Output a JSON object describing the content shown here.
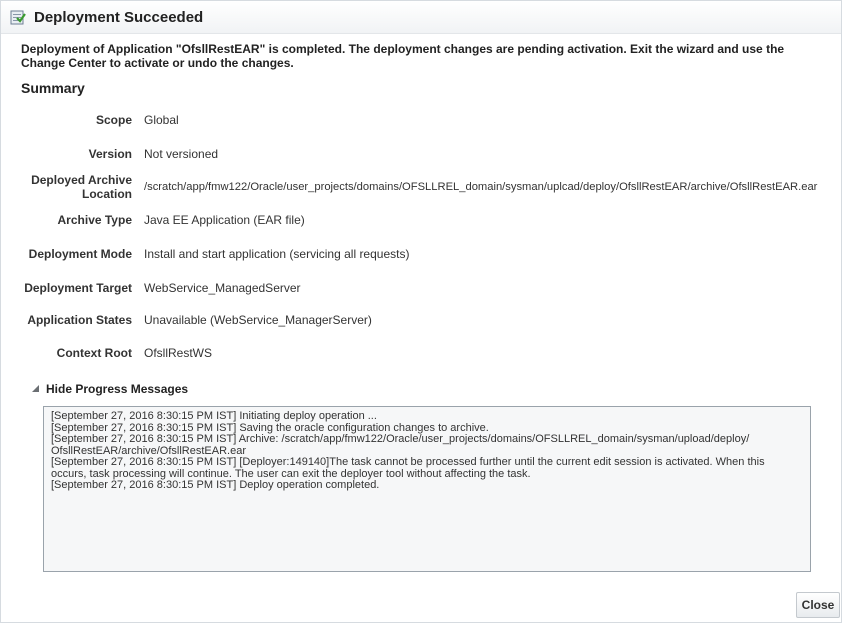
{
  "dialog": {
    "title": "Deployment Succeeded",
    "title_icon": "deployment-success-icon",
    "message": "Deployment of Application \"OfsllRestEAR\" is completed. The deployment changes are pending activation. Exit the wizard and use the Change Center to activate or undo the changes."
  },
  "summary": {
    "title": "Summary",
    "rows": [
      {
        "label": "Scope",
        "value": "Global"
      },
      {
        "label": "Version",
        "value": "Not versioned"
      },
      {
        "label": "Deployed Archive Location",
        "value": "/scratch/app/fmw122/Oracle/user_projects/domains/OFSLLREL_domain/sysman/uplcad/deploy/OfsllRestEAR/archive/OfsllRestEAR.ear"
      },
      {
        "label": "Archive Type",
        "value": "Java EE Application (EAR file)"
      },
      {
        "label": "Deployment Mode",
        "value": "Install and start application (servicing all requests)"
      },
      {
        "label": "Deployment Target",
        "value": "WebService_ManagedServer"
      },
      {
        "label": "Application States",
        "value": "Unavailable (WebService_ManagerServer)"
      },
      {
        "label": "Context Root",
        "value": "OfsllRestWS"
      }
    ]
  },
  "progress": {
    "toggle_label": "Hide Progress Messages",
    "toggle_icon": "triangle-expanded-icon",
    "messages": [
      "[September 27, 2016 8:30:15 PM IST] Initiating deploy operation ...",
      "[September 27, 2016 8:30:15 PM IST] Saving the oracle configuration changes to archive.",
      "[September 27, 2016 8:30:15 PM IST] Archive: /scratch/app/fmw122/Oracle/user_projects/domains/OFSLLREL_domain/sysman/upload/deploy/ OfsllRestEAR/archive/OfsllRestEAR.ear",
      "[September 27, 2016 8:30:15 PM IST] [Deployer:149140]The task cannot be processed further until the current edit session is activated. When this occurs, task processing will continue. The user can exit the deployer tool without affecting the task.",
      "[September 27, 2016 8:30:15 PM IST] Deploy operation completed."
    ]
  },
  "buttons": {
    "close_label": "Close"
  }
}
